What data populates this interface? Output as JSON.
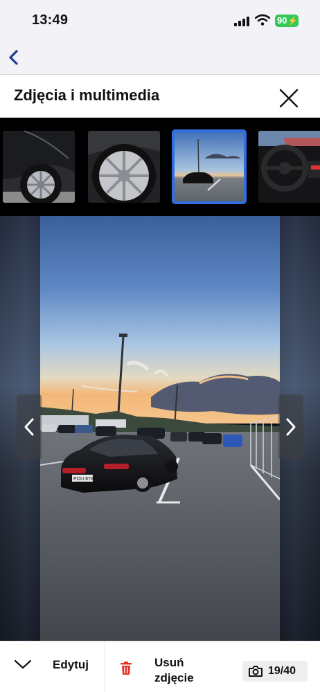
{
  "status_bar": {
    "time": "13:49",
    "battery": "90"
  },
  "header": {
    "title": "Zdjęcia i multimedia"
  },
  "thumbnails": [
    {
      "icon": "photo-rear-wheel"
    },
    {
      "icon": "photo-wheel-rim"
    },
    {
      "icon": "photo-car-parking",
      "selected": true
    },
    {
      "icon": "photo-interior-steering"
    }
  ],
  "viewer": {
    "plate_text": "POU 8764"
  },
  "toolbar": {
    "edit_label": "Edytuj",
    "delete_label": "Usuń zdjęcie",
    "counter": "19/40"
  },
  "colors": {
    "accent": "#2f6fe0",
    "back_arrow": "#1f3a8a",
    "delete_red": "#e5312b",
    "battery": "#34c759"
  }
}
